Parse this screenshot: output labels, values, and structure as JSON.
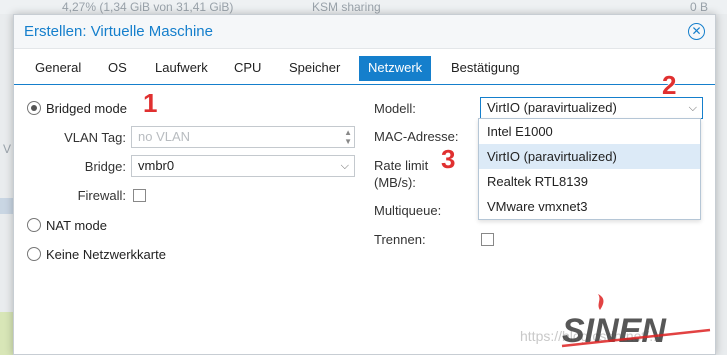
{
  "background": {
    "top_values": [
      "4,27% (1,34 GiB von 31,41 GiB)",
      "KSM sharing",
      "0 B"
    ],
    "side_letter": "V"
  },
  "dialog": {
    "title": "Erstellen: Virtuelle Maschine",
    "tabs": [
      {
        "label": "General",
        "active": false
      },
      {
        "label": "OS",
        "active": false
      },
      {
        "label": "Laufwerk",
        "active": false
      },
      {
        "label": "CPU",
        "active": false
      },
      {
        "label": "Speicher",
        "active": false
      },
      {
        "label": "Netzwerk",
        "active": true
      },
      {
        "label": "Bestätigung",
        "active": false
      }
    ]
  },
  "network": {
    "bridged_mode": {
      "label": "Bridged mode",
      "selected": true
    },
    "vlan_tag": {
      "label": "VLAN Tag:",
      "placeholder": "no VLAN"
    },
    "bridge": {
      "label": "Bridge:",
      "value": "vmbr0"
    },
    "firewall": {
      "label": "Firewall:",
      "checked": false
    },
    "nat_mode": {
      "label": "NAT mode",
      "selected": false
    },
    "no_nic": {
      "label": "Keine Netzwerkkarte",
      "selected": false
    },
    "model": {
      "label": "Modell:",
      "value": "VirtIO (paravirtualized)"
    },
    "mac": {
      "label": "MAC-Adresse:"
    },
    "rate_limit": {
      "label_line1": "Rate limit",
      "label_line2": "(MB/s):"
    },
    "multiqueue": {
      "label": "Multiqueue:"
    },
    "disconnect": {
      "label": "Trennen:",
      "checked": false
    }
  },
  "model_dropdown": {
    "options": [
      "Intel E1000",
      "VirtIO (paravirtualized)",
      "Realtek RTL8139",
      "VMware vmxnet3"
    ],
    "selected_index": 1
  },
  "annotations": [
    "1",
    "2",
    "3"
  ],
  "watermark": {
    "url": "https://blog.csdn.net/..."
  },
  "colors": {
    "accent": "#157fcc",
    "annotation": "#e03030",
    "selected_row": "#dceaf7"
  }
}
